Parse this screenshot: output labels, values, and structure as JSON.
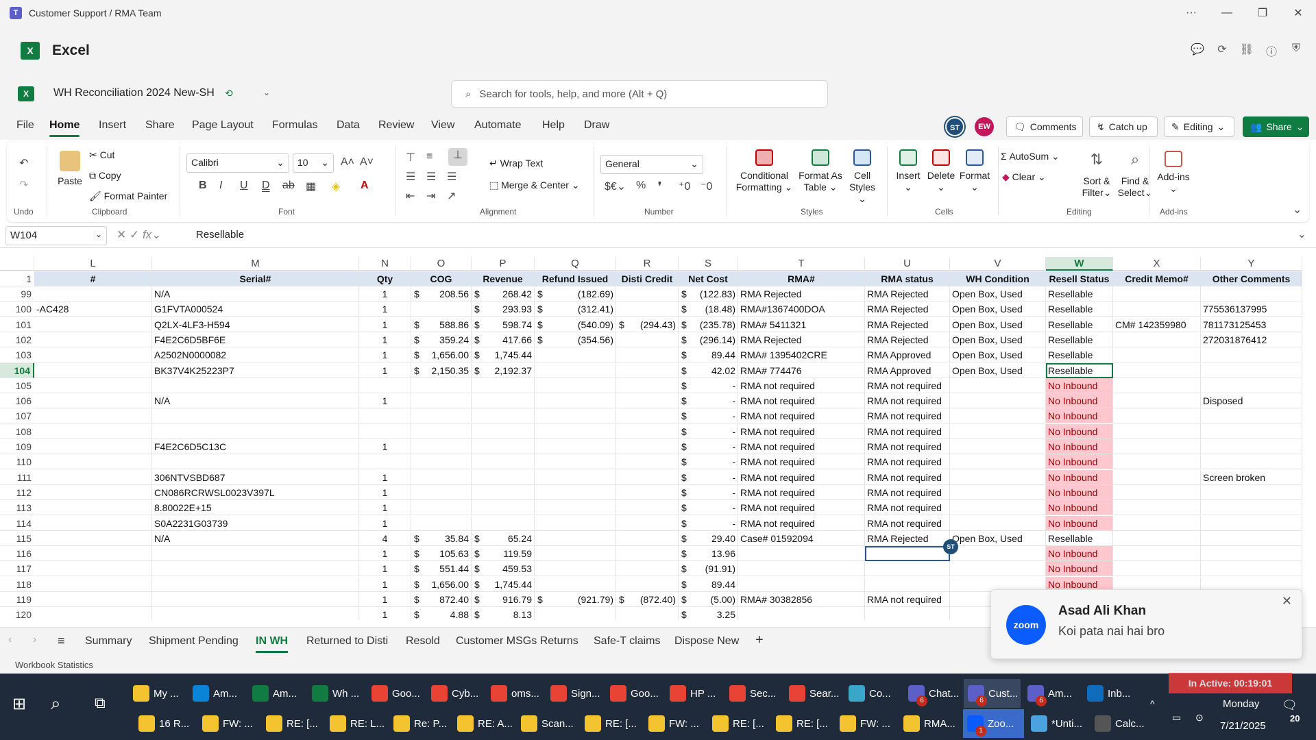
{
  "window": {
    "title": "Customer Support / RMA Team"
  },
  "app": {
    "name": "Excel"
  },
  "doc": {
    "name": "WH Reconciliation 2024 New-SH"
  },
  "search": {
    "placeholder": "Search for tools, help, and more (Alt + Q)"
  },
  "menu": {
    "tabs": [
      "File",
      "Home",
      "Insert",
      "Share",
      "Page Layout",
      "Formulas",
      "Data",
      "Review",
      "View",
      "Automate",
      "Help",
      "Draw"
    ],
    "active": "Home"
  },
  "collab": {
    "avatar1": "ST",
    "avatar2": "EW",
    "comments": "Comments",
    "catchup": "Catch up",
    "editing": "Editing",
    "share": "Share"
  },
  "ribbon": {
    "undo_label": "Undo",
    "paste": "Paste",
    "cut": "Cut",
    "copy": "Copy",
    "format_painter": "Format Painter",
    "clipboard": "Clipboard",
    "font_name": "Calibri",
    "font_size": "10",
    "font": "Font",
    "wrap_text": "Wrap Text",
    "merge_center": "Merge & Center",
    "alignment": "Alignment",
    "number_format": "General",
    "number": "Number",
    "cond_fmt_1": "Conditional",
    "cond_fmt_2": "Formatting",
    "fmt_table_1": "Format As",
    "fmt_table_2": "Table",
    "cell_styles_1": "Cell",
    "cell_styles_2": "Styles",
    "styles": "Styles",
    "insert": "Insert",
    "delete": "Delete",
    "format": "Format",
    "cells": "Cells",
    "autosum": "AutoSum",
    "clear": "Clear",
    "sort_1": "Sort &",
    "sort_2": "Filter",
    "find_1": "Find &",
    "find_2": "Select",
    "editing": "Editing",
    "addins": "Add-ins",
    "addins_group": "Add-ins"
  },
  "formula": {
    "name_box": "W104",
    "value": "Resellable"
  },
  "grid": {
    "columns": [
      "L",
      "M",
      "N",
      "O",
      "P",
      "Q",
      "R",
      "S",
      "T",
      "U",
      "V",
      "W",
      "X",
      "Y"
    ],
    "selected_column": "W",
    "header_row_num": "1",
    "headers": [
      "#",
      "Serial#",
      "Qty",
      "COG",
      "Revenue",
      "Refund Issued",
      "Disti Credit",
      "Net Cost",
      "RMA#",
      "RMA status",
      "WH Condition",
      "Resell Status",
      "Credit Memo#",
      "Other Comments"
    ],
    "active_row": "104",
    "rows": [
      {
        "n": "99",
        "L": "",
        "M": "N/A",
        "N": "1",
        "O": "208.56",
        "P": "268.42",
        "Q": "(182.69)",
        "R": "",
        "S": "(122.83)",
        "T": "RMA Rejected",
        "U": "RMA Rejected",
        "V": "Open Box, Used",
        "W": "Resellable",
        "X": "",
        "Y": ""
      },
      {
        "n": "100",
        "L": "-AC428",
        "M": "G1FVTA000524",
        "N": "1",
        "O": "",
        "P": "293.93",
        "Q": "(312.41)",
        "R": "",
        "S": "(18.48)",
        "T": "RMA#1367400DOA",
        "U": "RMA Rejected",
        "V": "Open Box, Used",
        "W": "Resellable",
        "X": "",
        "Y": "775536137995"
      },
      {
        "n": "101",
        "L": "",
        "M": "Q2LX-4LF3-H594",
        "N": "1",
        "O": "588.86",
        "P": "598.74",
        "Q": "(540.09)",
        "R": "(294.43)",
        "S": "(235.78)",
        "T": "RMA# 5411321",
        "U": "RMA Rejected",
        "V": "Open Box, Used",
        "W": "Resellable",
        "X": "CM# 142359980",
        "Y": "781173125453"
      },
      {
        "n": "102",
        "L": "",
        "M": "F4E2C6D5BF6E",
        "N": "1",
        "O": "359.24",
        "P": "417.66",
        "Q": "(354.56)",
        "R": "",
        "S": "(296.14)",
        "T": "RMA Rejected",
        "U": "RMA Rejected",
        "V": "Open Box, Used",
        "W": "Resellable",
        "X": "",
        "Y": "272031876412"
      },
      {
        "n": "103",
        "L": "",
        "M": "A2502N0000082",
        "N": "1",
        "O": "1,656.00",
        "P": "1,745.44",
        "Q": "",
        "R": "",
        "S": "89.44",
        "T": "RMA# 1395402CRE",
        "U": "RMA Approved",
        "V": "Open Box, Used",
        "W": "Resellable",
        "X": "",
        "Y": ""
      },
      {
        "n": "104",
        "L": "",
        "M": "BK37V4K25223P7",
        "N": "1",
        "O": "2,150.35",
        "P": "2,192.37",
        "Q": "",
        "R": "",
        "S": "42.02",
        "T": "RMA# 774476",
        "U": "RMA Approved",
        "V": "Open Box, Used",
        "W": "Resellable",
        "X": "",
        "Y": ""
      },
      {
        "n": "105",
        "L": "",
        "M": "",
        "N": "",
        "O": "",
        "P": "",
        "Q": "",
        "R": "",
        "S": "-",
        "T": "RMA not required",
        "U": "RMA not required",
        "V": "",
        "W": "No Inbound",
        "X": "",
        "Y": ""
      },
      {
        "n": "106",
        "L": "",
        "M": "N/A",
        "N": "1",
        "O": "",
        "P": "",
        "Q": "",
        "R": "",
        "S": "-",
        "T": "RMA not required",
        "U": "RMA not required",
        "V": "",
        "W": "No Inbound",
        "X": "",
        "Y": "Disposed"
      },
      {
        "n": "107",
        "L": "",
        "M": "",
        "N": "",
        "O": "",
        "P": "",
        "Q": "",
        "R": "",
        "S": "-",
        "T": "RMA not required",
        "U": "RMA not required",
        "V": "",
        "W": "No Inbound",
        "X": "",
        "Y": ""
      },
      {
        "n": "108",
        "L": "",
        "M": "",
        "N": "",
        "O": "",
        "P": "",
        "Q": "",
        "R": "",
        "S": "-",
        "T": "RMA not required",
        "U": "RMA not required",
        "V": "",
        "W": "No Inbound",
        "X": "",
        "Y": ""
      },
      {
        "n": "109",
        "L": "",
        "M": "F4E2C6D5C13C",
        "N": "1",
        "O": "",
        "P": "",
        "Q": "",
        "R": "",
        "S": "-",
        "T": "RMA not required",
        "U": "RMA not required",
        "V": "",
        "W": "No Inbound",
        "X": "",
        "Y": ""
      },
      {
        "n": "110",
        "L": "",
        "M": "",
        "N": "",
        "O": "",
        "P": "",
        "Q": "",
        "R": "",
        "S": "-",
        "T": "RMA not required",
        "U": "RMA not required",
        "V": "",
        "W": "No Inbound",
        "X": "",
        "Y": ""
      },
      {
        "n": "111",
        "L": "",
        "M": "306NTVSBD687",
        "N": "1",
        "O": "",
        "P": "",
        "Q": "",
        "R": "",
        "S": "-",
        "T": "RMA not required",
        "U": "RMA not required",
        "V": "",
        "W": "No Inbound",
        "X": "",
        "Y": "Screen broken"
      },
      {
        "n": "112",
        "L": "",
        "M": "CN086RCRWSL0023V397L",
        "N": "1",
        "O": "",
        "P": "",
        "Q": "",
        "R": "",
        "S": "-",
        "T": "RMA not required",
        "U": "RMA not required",
        "V": "",
        "W": "No Inbound",
        "X": "",
        "Y": ""
      },
      {
        "n": "113",
        "L": "",
        "M": "8.80022E+15",
        "N": "1",
        "O": "",
        "P": "",
        "Q": "",
        "R": "",
        "S": "-",
        "T": "RMA not required",
        "U": "RMA not required",
        "V": "",
        "W": "No Inbound",
        "X": "",
        "Y": ""
      },
      {
        "n": "114",
        "L": "",
        "M": "S0A2231G03739",
        "N": "1",
        "O": "",
        "P": "",
        "Q": "",
        "R": "",
        "S": "-",
        "T": "RMA not required",
        "U": "RMA not required",
        "V": "",
        "W": "No Inbound",
        "X": "",
        "Y": ""
      },
      {
        "n": "115",
        "L": "",
        "M": "N/A",
        "N": "4",
        "O": "35.84",
        "P": "65.24",
        "Q": "",
        "R": "",
        "S": "29.40",
        "T": "Case# 01592094",
        "U": "RMA Rejected",
        "V": "Open Box, Used",
        "W": "Resellable",
        "X": "",
        "Y": ""
      },
      {
        "n": "116",
        "L": "",
        "M": "",
        "N": "1",
        "O": "105.63",
        "P": "119.59",
        "Q": "",
        "R": "",
        "S": "13.96",
        "T": "",
        "U": "",
        "V": "",
        "W": "No Inbound",
        "X": "",
        "Y": ""
      },
      {
        "n": "117",
        "L": "",
        "M": "",
        "N": "1",
        "O": "551.44",
        "P": "459.53",
        "Q": "",
        "R": "",
        "S": "(91.91)",
        "T": "",
        "U": "",
        "V": "",
        "W": "No Inbound",
        "X": "",
        "Y": ""
      },
      {
        "n": "118",
        "L": "",
        "M": "",
        "N": "1",
        "O": "1,656.00",
        "P": "1,745.44",
        "Q": "",
        "R": "",
        "S": "89.44",
        "T": "",
        "U": "",
        "V": "",
        "W": "No Inbound",
        "X": "",
        "Y": ""
      },
      {
        "n": "119",
        "L": "",
        "M": "",
        "N": "1",
        "O": "872.40",
        "P": "916.79",
        "Q": "(921.79)",
        "R": "(872.40)",
        "S": "(5.00)",
        "T": "RMA# 30382856",
        "U": "RMA not required",
        "V": "",
        "W": "",
        "X": "",
        "Y": ""
      },
      {
        "n": "120",
        "L": "",
        "M": "",
        "N": "1",
        "O": "4.88",
        "P": "8.13",
        "Q": "",
        "R": "",
        "S": "3.25",
        "T": "",
        "U": "",
        "V": "",
        "W": "",
        "X": "",
        "Y": ""
      }
    ],
    "presence_tag": "ST"
  },
  "sheets": {
    "tabs": [
      "Summary",
      "Shipment Pending",
      "IN WH",
      "Returned to Disti",
      "Resold",
      "Customer MSGs Returns",
      "Safe-T claims",
      "Dispose New"
    ],
    "active": "IN WH"
  },
  "status": {
    "left": "Workbook Statistics"
  },
  "toast": {
    "name": "Asad Ali Khan",
    "message": "Koi pata nai hai bro",
    "logo": "zoom"
  },
  "inactive_timer": "In Active: 00:19:01",
  "taskbar": {
    "row1": [
      {
        "label": "My ...",
        "color": "#f4c430"
      },
      {
        "label": "Am...",
        "color": "#0a84d6"
      },
      {
        "label": "Am...",
        "color": "#107c41"
      },
      {
        "label": "Wh ...",
        "color": "#107c41"
      },
      {
        "label": "Goo...",
        "color": "#e94335"
      },
      {
        "label": "Cyb...",
        "color": "#e94335"
      },
      {
        "label": "oms...",
        "color": "#e94335"
      },
      {
        "label": "Sign...",
        "color": "#e94335"
      },
      {
        "label": "Goo...",
        "color": "#e94335"
      },
      {
        "label": "HP ...",
        "color": "#e94335"
      },
      {
        "label": "Sec...",
        "color": "#e94335"
      },
      {
        "label": "Sear...",
        "color": "#e94335"
      },
      {
        "label": "Co...",
        "color": "#3aa7c9"
      },
      {
        "label": "Chat...",
        "color": "#5b5fc7",
        "badge": "6"
      },
      {
        "label": "Cust...",
        "color": "#5b5fc7",
        "badge": "6",
        "active": true
      },
      {
        "label": "Am...",
        "color": "#5b5fc7",
        "badge": "6"
      },
      {
        "label": "Inb...",
        "color": "#0f6cbd"
      }
    ],
    "row2": [
      {
        "label": "16 R...",
        "color": "#f4c430"
      },
      {
        "label": "FW: ...",
        "color": "#f4c430"
      },
      {
        "label": "RE: [...",
        "color": "#f4c430"
      },
      {
        "label": "RE: L...",
        "color": "#f4c430"
      },
      {
        "label": "Re: P...",
        "color": "#f4c430"
      },
      {
        "label": "RE: A...",
        "color": "#f4c430"
      },
      {
        "label": "Scan...",
        "color": "#f4c430"
      },
      {
        "label": "RE: [...",
        "color": "#f4c430"
      },
      {
        "label": "FW: ...",
        "color": "#f4c430"
      },
      {
        "label": "RE: [...",
        "color": "#f4c430"
      },
      {
        "label": "RE: [...",
        "color": "#f4c430"
      },
      {
        "label": "FW: ...",
        "color": "#f4c430"
      },
      {
        "label": "RMA...",
        "color": "#f4c430"
      },
      {
        "label": "Zoo...",
        "color": "#0b5cff",
        "badge": "1",
        "active2": true
      },
      {
        "label": "*Unti...",
        "color": "#4aa3df"
      },
      {
        "label": "Calc...",
        "color": "#555"
      }
    ],
    "day": "Monday",
    "date": "7/21/2025",
    "notif_count": "20"
  }
}
